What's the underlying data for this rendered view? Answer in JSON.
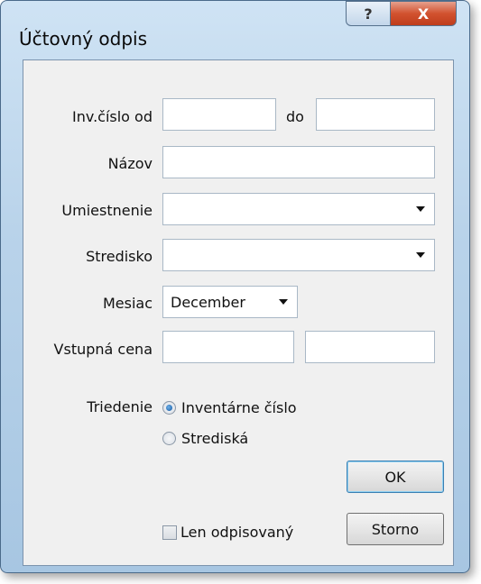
{
  "window": {
    "title": "Účtovný odpis",
    "help_label": "?",
    "close_label": "X"
  },
  "form": {
    "inv_cislo_od_label": "Inv.číslo od",
    "inv_cislo_od_value": "",
    "do_label": "do",
    "do_value": "",
    "nazov_label": "Názov",
    "nazov_value": "",
    "umiestnenie_label": "Umiestnenie",
    "umiestnenie_value": "",
    "stredisko_label": "Stredisko",
    "stredisko_value": "",
    "mesiac_label": "Mesiac",
    "mesiac_value": "December",
    "vstupna_cena_label": "Vstupná cena",
    "vstupna_cena_from": "",
    "vstupna_cena_to": ""
  },
  "sorting": {
    "label": "Triedenie",
    "options": [
      "Inventárne číslo",
      "Strediská"
    ],
    "selected": "Inventárne číslo"
  },
  "checkbox": {
    "label": "Len odpisovaný",
    "checked": false
  },
  "buttons": {
    "ok_label": "OK",
    "storno_label": "Storno"
  },
  "colors": {
    "close_button": "#c8482a",
    "default_button_border": "#3c7fb1"
  }
}
